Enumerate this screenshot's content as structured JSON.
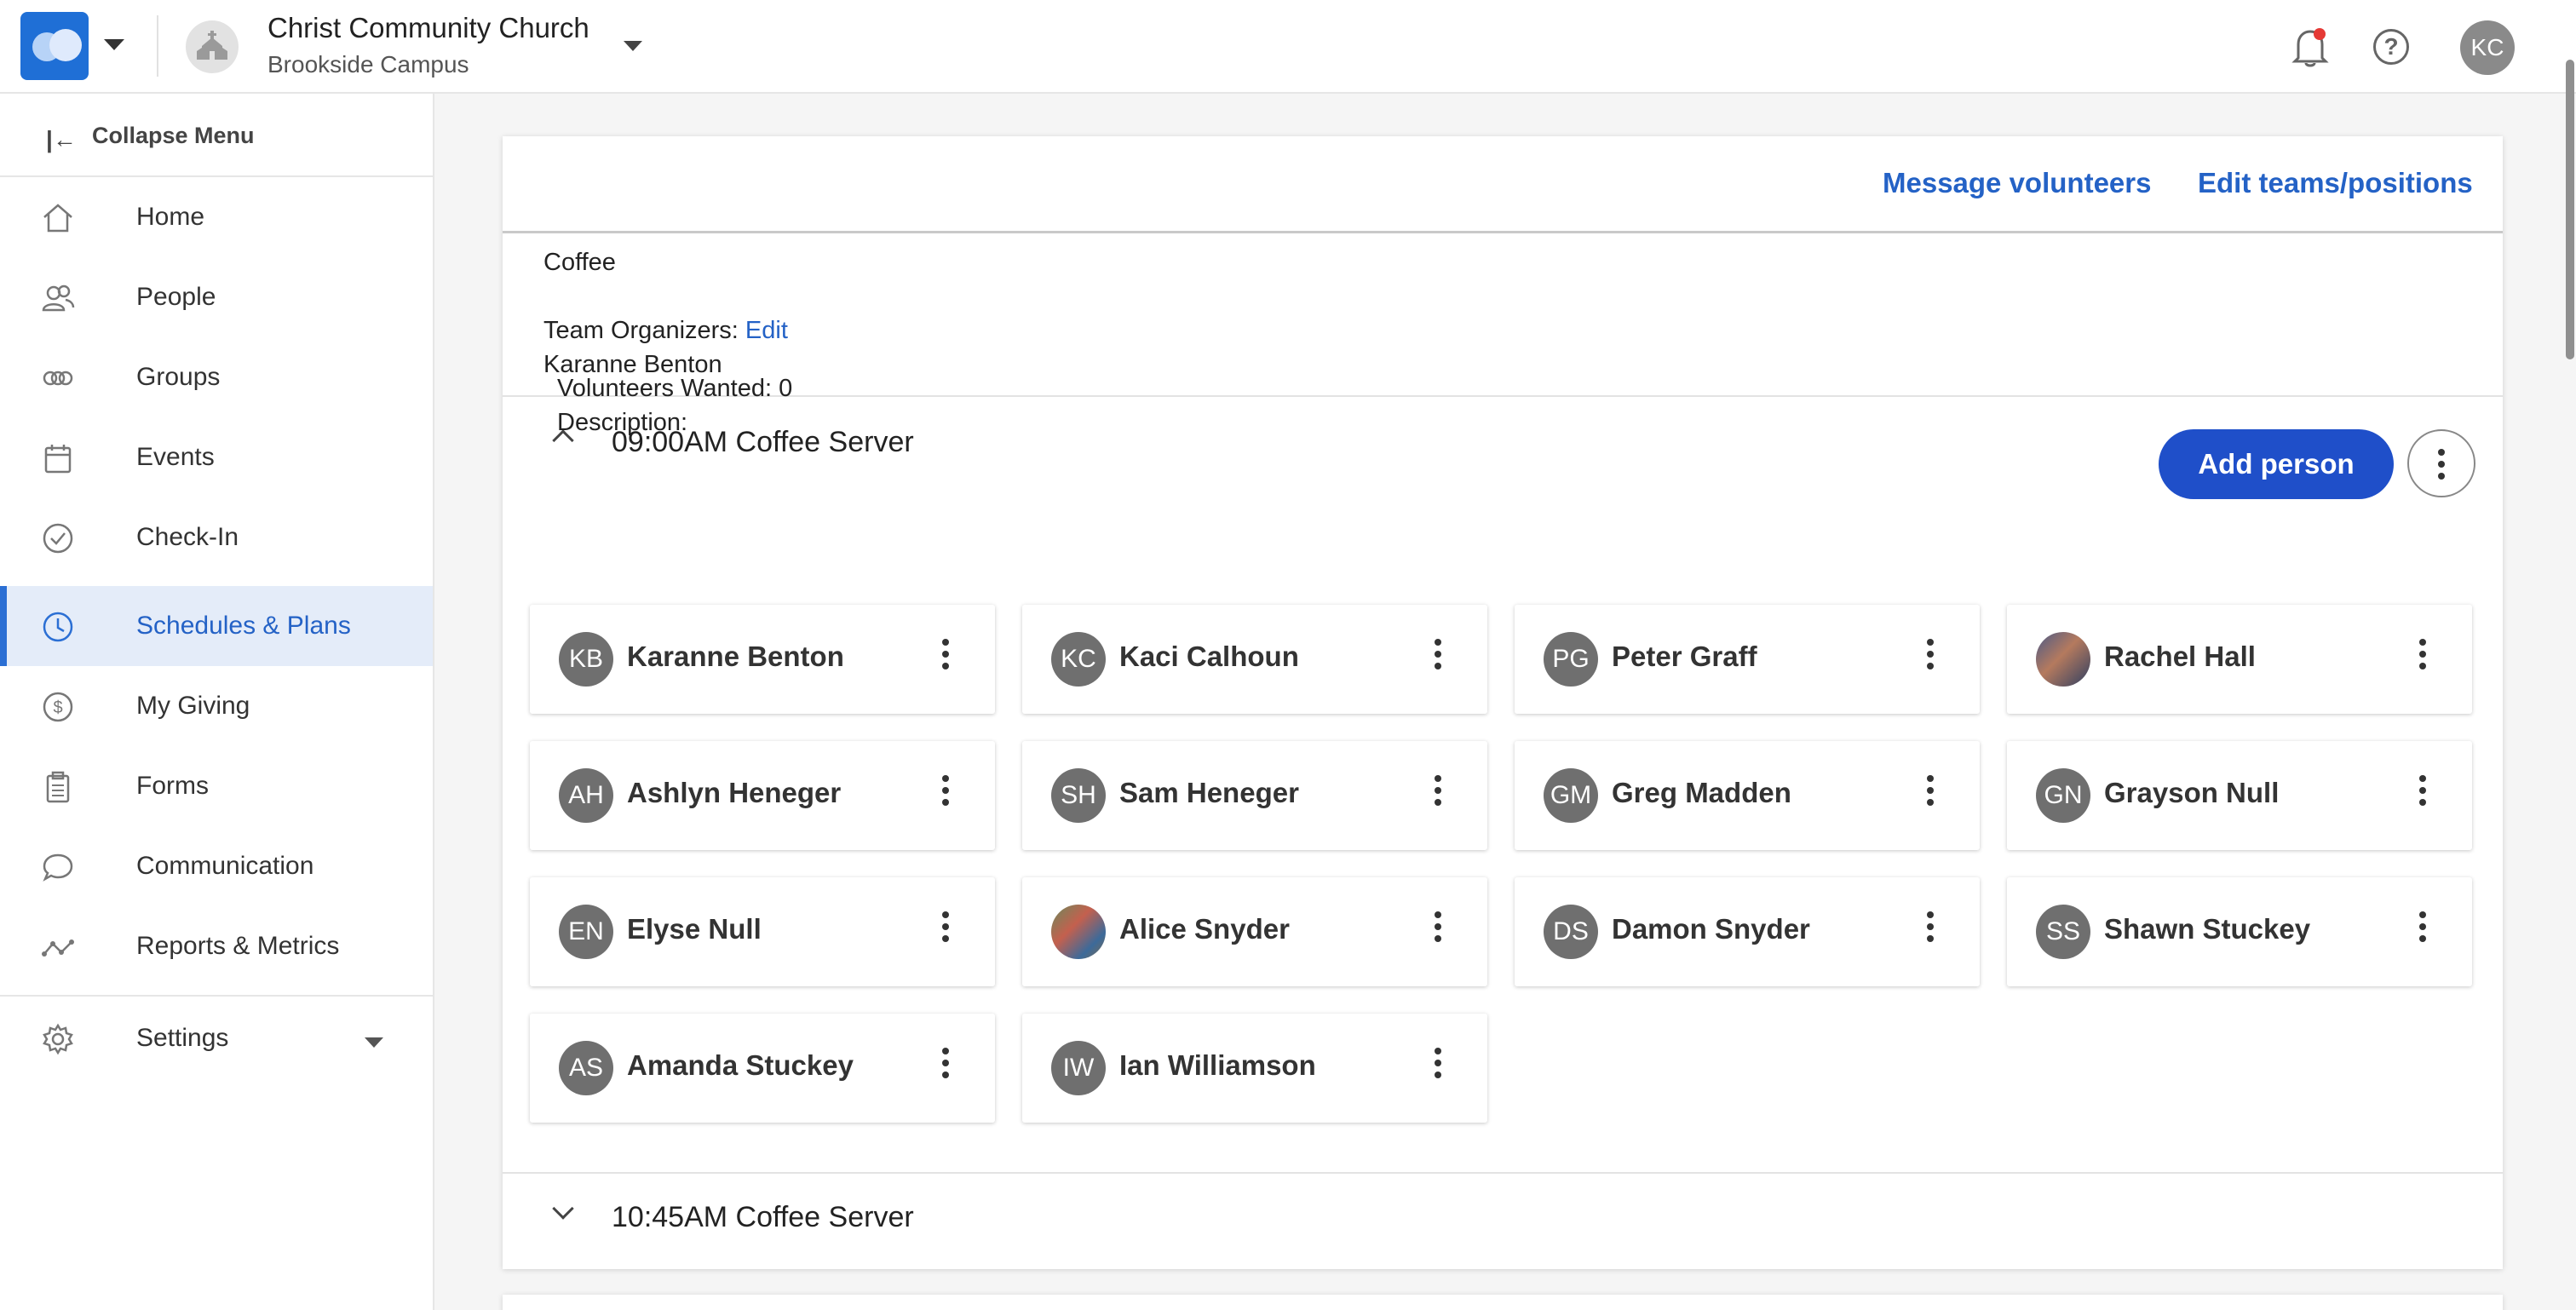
{
  "header": {
    "org_name": "Christ Community Church",
    "campus": "Brookside Campus",
    "user_initials": "KC",
    "help_label": "?"
  },
  "sidebar": {
    "collapse_label": "Collapse Menu",
    "items": [
      {
        "label": "Home",
        "icon": "home-icon"
      },
      {
        "label": "People",
        "icon": "people-icon"
      },
      {
        "label": "Groups",
        "icon": "groups-icon"
      },
      {
        "label": "Events",
        "icon": "calendar-icon"
      },
      {
        "label": "Check-In",
        "icon": "check-circle-icon"
      },
      {
        "label": "Schedules & Plans",
        "icon": "clock-icon",
        "active": true
      },
      {
        "label": "My Giving",
        "icon": "dollar-icon"
      },
      {
        "label": "Forms",
        "icon": "clipboard-icon"
      },
      {
        "label": "Communication",
        "icon": "chat-icon"
      },
      {
        "label": "Reports & Metrics",
        "icon": "chart-line-icon"
      }
    ],
    "settings_label": "Settings"
  },
  "team": {
    "message_label": "Message volunteers",
    "edit_label": "Edit teams/positions",
    "name": "Coffee",
    "organizers_label": "Team Organizers:",
    "organizers_edit": "Edit",
    "organizer": "Karanne Benton"
  },
  "position1": {
    "title": "09:00AM Coffee Server",
    "volunteers_wanted": "Volunteers Wanted: 0",
    "description": "Description:",
    "add_label": "Add person",
    "volunteers": [
      {
        "initials": "KB",
        "name": "Karanne Benton"
      },
      {
        "initials": "KC",
        "name": "Kaci Calhoun"
      },
      {
        "initials": "PG",
        "name": "Peter Graff"
      },
      {
        "initials": "",
        "name": "Rachel Hall"
      },
      {
        "initials": "AH",
        "name": "Ashlyn Heneger"
      },
      {
        "initials": "SH",
        "name": "Sam Heneger"
      },
      {
        "initials": "GM",
        "name": "Greg Madden"
      },
      {
        "initials": "GN",
        "name": "Grayson Null"
      },
      {
        "initials": "EN",
        "name": "Elyse Null"
      },
      {
        "initials": "",
        "name": "Alice Snyder"
      },
      {
        "initials": "DS",
        "name": "Damon Snyder"
      },
      {
        "initials": "SS",
        "name": "Shawn Stuckey"
      },
      {
        "initials": "AS",
        "name": "Amanda Stuckey"
      },
      {
        "initials": "IW",
        "name": "Ian Williamson"
      }
    ]
  },
  "position2": {
    "title": "10:45AM Coffee Server"
  }
}
